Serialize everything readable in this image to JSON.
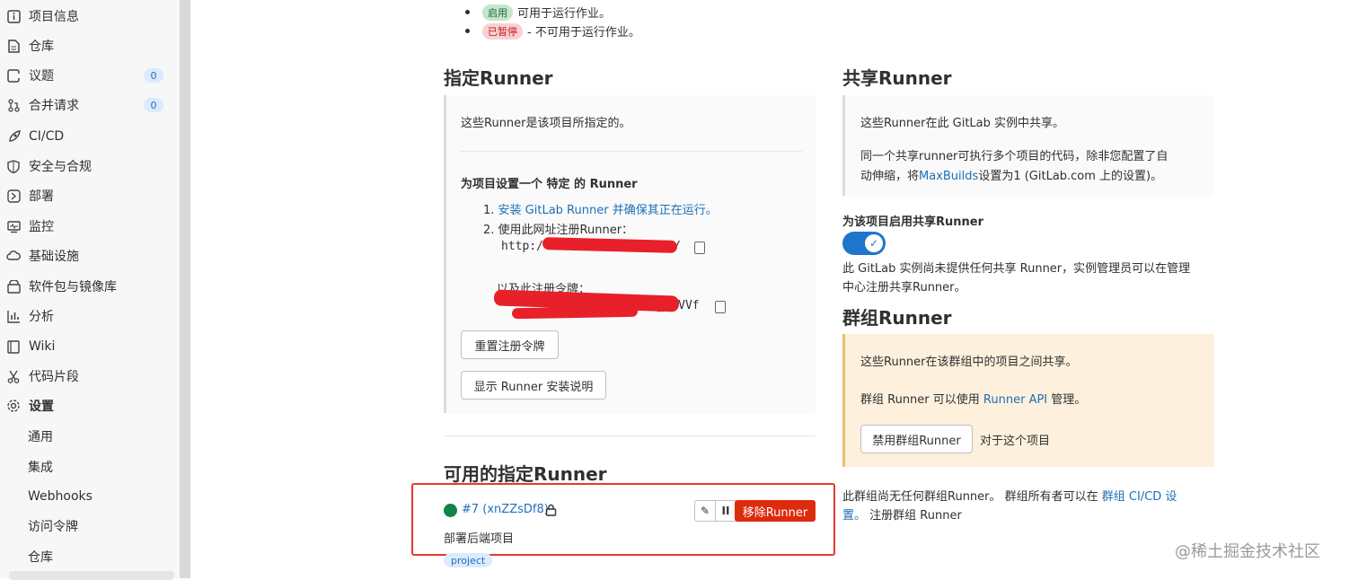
{
  "sidebar": {
    "items": [
      {
        "label": "项目信息",
        "icon": "info-icon"
      },
      {
        "label": "仓库",
        "icon": "document-icon"
      },
      {
        "label": "议题",
        "icon": "issues-icon",
        "count": "0"
      },
      {
        "label": "合并请求",
        "icon": "merge-request-icon",
        "count": "0"
      },
      {
        "label": "CI/CD",
        "icon": "rocket-icon"
      },
      {
        "label": "安全与合规",
        "icon": "shield-icon"
      },
      {
        "label": "部署",
        "icon": "deploy-icon"
      },
      {
        "label": "监控",
        "icon": "monitor-icon"
      },
      {
        "label": "基础设施",
        "icon": "cloud-icon"
      },
      {
        "label": "软件包与镜像库",
        "icon": "package-icon"
      },
      {
        "label": "分析",
        "icon": "chart-icon"
      },
      {
        "label": "Wiki",
        "icon": "book-icon"
      },
      {
        "label": "代码片段",
        "icon": "scissors-icon"
      },
      {
        "label": "设置",
        "icon": "gear-icon"
      }
    ],
    "sub_items": [
      "通用",
      "集成",
      "Webhooks",
      "访问令牌",
      "仓库"
    ]
  },
  "status_legend": [
    {
      "pill": "启用",
      "text": "可用于运行作业。",
      "color": "#c3e6cd"
    },
    {
      "pill": "已暂停",
      "text": "- 不可用于运行作业。",
      "color": "#fad0d2"
    }
  ],
  "specific": {
    "title": "指定Runner",
    "desc": "这些Runner是该项目所指定的。",
    "setup_title": "为项目设置一个 特定 的 Runner",
    "step1_num": "1.",
    "step1_link": "安装 GitLab Runner 并确保其正在运行。",
    "step2": "2. 使用此网址注册Runner：",
    "url_visible_prefix": "http:/",
    "url_visible_suffix": "/",
    "token_label": "以及此注册令牌：",
    "token_visible_suffix": "ab_YUVVf",
    "reset_button": "重置注册令牌",
    "show_instructions_button": "显示 Runner 安装说明"
  },
  "available": {
    "title": "可用的指定Runner",
    "runner_id": "#7 (xnZZsDf8)",
    "runner_desc": "部署后端项目",
    "remove_button": "移除Runner",
    "tag": "project"
  },
  "shared": {
    "title": "共享Runner",
    "desc1": "这些Runner在此 GitLab 实例中共享。",
    "desc2_line1": "同一个共享runner可执行多个项目的代码，除非您配置了自",
    "desc2_line2_pre": "动伸缩，将",
    "desc2_link": "MaxBuilds",
    "desc2_line2_post": "设置为1 (GitLab.com 上的设置)。",
    "enable_label": "为该项目启用共享Runner",
    "enabled": true,
    "note_line1": "此 GitLab 实例尚未提供任何共享 Runner，实例管理员可以在管理",
    "note_line2": "中心注册共享Runner。"
  },
  "group": {
    "title": "群组Runner",
    "desc1": "这些Runner在该群组中的项目之间共享。",
    "desc2_pre": "群组 Runner 可以使用 ",
    "desc2_link": "Runner API",
    "desc2_post": " 管理。",
    "disable_button": "禁用群组Runner",
    "disable_suffix": "对于这个项目",
    "note_pre": "此群组尚无任何群组Runner。 群组所有者可以在 ",
    "note_link1": "群组 CI/CD 设",
    "note_link2": "置。",
    "note_post": " 注册群组 Runner"
  },
  "watermark": "@稀土掘金技术社区",
  "colors": {
    "accent": "#1f75cb",
    "danger": "#dd2b0e",
    "success": "#108548"
  }
}
